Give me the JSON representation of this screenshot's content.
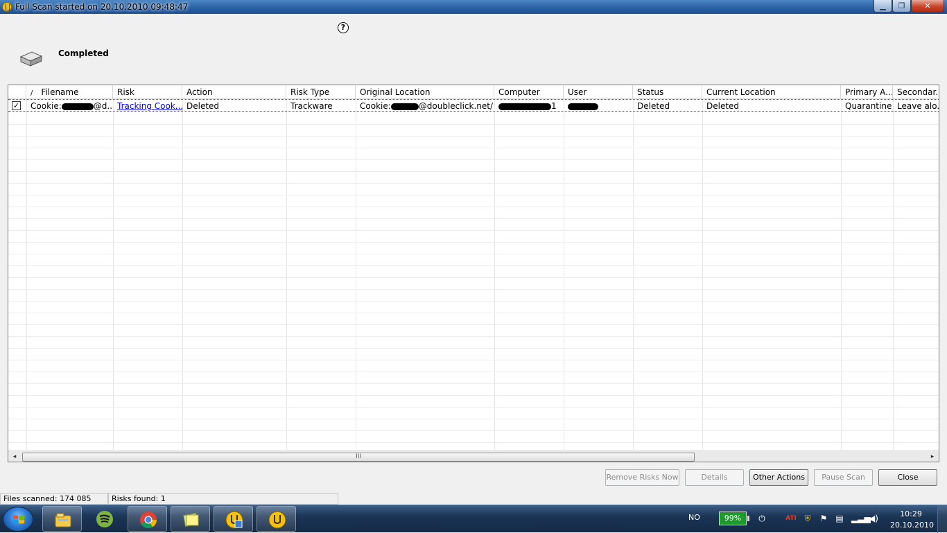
{
  "window": {
    "title": "Full Scan started on 20.10.2010 09:48:47",
    "min_glyph": "▁",
    "max_glyph": "❐",
    "close_glyph": "✕"
  },
  "header": {
    "help_glyph": "?",
    "status": "Completed"
  },
  "table": {
    "sort_indicator": "/",
    "columns": [
      "Filename",
      "Risk",
      "Action",
      "Risk Type",
      "Original Location",
      "Computer",
      "User",
      "Status",
      "Current Location",
      "Primary A...",
      "Secondar..."
    ],
    "rows": [
      {
        "checked": true,
        "filename_prefix": "Cookie:",
        "filename_suffix": "@d...",
        "risk": "Tracking Cook...",
        "action": "Deleted",
        "risk_type": "Trackware",
        "original_location_prefix": "Cookie:",
        "original_location_suffix": "@doubleclick.net/",
        "computer_suffix": "1",
        "status": "Deleted",
        "current_location": "Deleted",
        "primary_action": "Quarantine",
        "secondary_action": "Leave alo..."
      }
    ],
    "check_glyph": "✓",
    "scroll_left": "◂",
    "scroll_right": "▸",
    "thumb_grip": "III"
  },
  "buttons": {
    "remove_risks": "Remove Risks Now",
    "details": "Details",
    "other_actions": "Other Actions",
    "pause_scan": "Pause Scan",
    "close": "Close"
  },
  "statusbar": {
    "files_scanned": "Files scanned: 174 085",
    "risks_found": "Risks found: 1"
  },
  "taskbar": {
    "language": "NO",
    "battery": "99%",
    "time": "10:29",
    "date": "20.10.2010",
    "items": [
      "explorer-icon",
      "spotify-icon",
      "chrome-icon",
      "sticky-notes-icon",
      "norton-security-icon",
      "norton-scan-icon"
    ]
  },
  "colors": {
    "link": "#0000ee",
    "battery": "#1e9a2c",
    "titlebar": "#2e64a8"
  }
}
